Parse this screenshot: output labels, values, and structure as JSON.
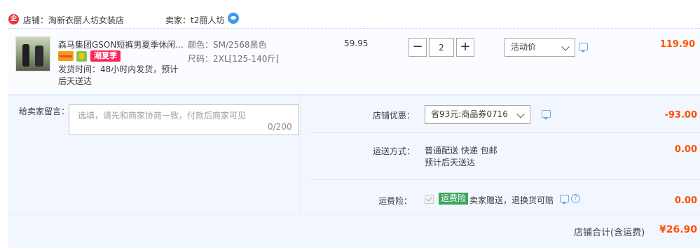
{
  "shop": {
    "label": "店铺：淘新衣丽人坊女装店",
    "seller": "卖家：t2丽人坊",
    "icon": "shop-icon",
    "chat_icon": "wangwang-chat-icon"
  },
  "item": {
    "title": "森马集团GSON短裤男夏季休闲...",
    "badge_summer": "潮夏季",
    "ship_time": "发货时间：48小时内发货，预计后天送达",
    "sku_color": "颜色：SM/2568黑色",
    "sku_size": "尺码：2XL[125-140斤]",
    "unit_price": "59.95",
    "qty": "2",
    "qty_minus": "−",
    "qty_plus": "+",
    "promo": "活动价",
    "total": "119.90"
  },
  "order": {
    "message_label": "给卖家留言：",
    "message_placeholder": "选填，请先和商家协商一致，付款后商家可见",
    "message_count": "0/200",
    "discount_label": "店铺优惠：",
    "discount_option": "省93元:商品券0716",
    "discount_amount": "-93.00",
    "delivery_label": "运送方式：",
    "delivery_method": "普通配送 快递 包邮",
    "delivery_eta": "预计后天送达",
    "delivery_amount": "0.00",
    "insurance_label": "运费险：",
    "insurance_badge": "运费险",
    "insurance_text": "卖家赠送，退换货可赔",
    "insurance_amount": "0.00",
    "help": "?"
  },
  "summary": {
    "label": "店铺合计(含运费)",
    "amount": "¥26.90"
  },
  "colors": {
    "accent": "#ff5000",
    "badge": "#ff2456",
    "insurance": "#3fa55b",
    "panel": "#f2f7ff"
  }
}
